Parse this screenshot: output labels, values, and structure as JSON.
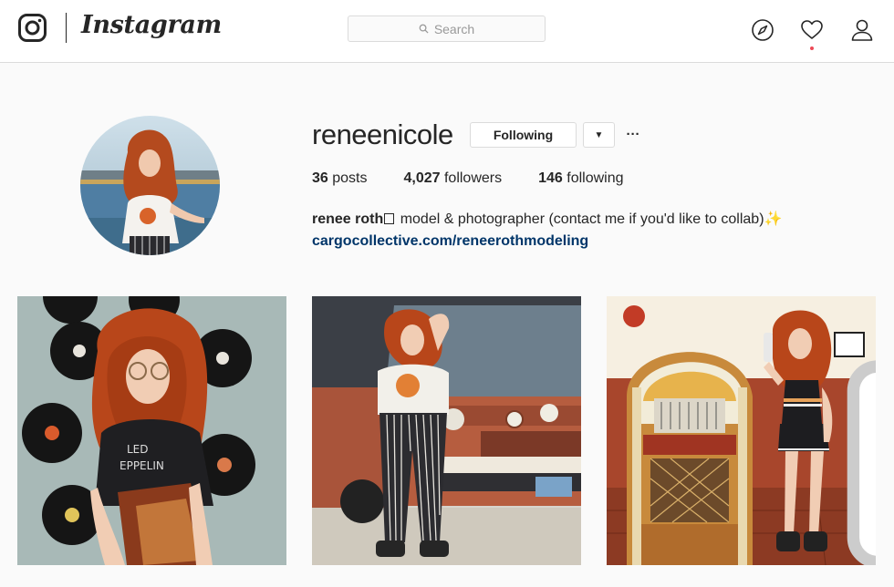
{
  "nav": {
    "wordmark": "Instagram",
    "search_placeholder": "Search",
    "icons": [
      "instagram-glyph-icon",
      "search-icon",
      "compass-icon",
      "heart-icon",
      "person-icon"
    ]
  },
  "profile": {
    "username": "reneenicole",
    "following_button": "Following",
    "dropdown_glyph": "▼",
    "more_glyph": "···",
    "stats": {
      "posts_count": "36",
      "posts_label": " posts",
      "followers_count": "4,027",
      "followers_label": " followers",
      "following_count": "146",
      "following_label": " following"
    },
    "bio": {
      "name": "renee roth",
      "text": " model & photographer (contact me if you'd like to collab)",
      "sparkle": "✨",
      "link": "cargocollective.com/reneerothmodeling"
    }
  },
  "posts": [
    {
      "subject": "records-wall-photo"
    },
    {
      "subject": "van-photo"
    },
    {
      "subject": "jukebox-photo",
      "multi": true
    }
  ],
  "colors": {
    "background": "#fafafa",
    "border": "#dbdbdb",
    "text": "#262626",
    "link": "#003569",
    "notification": "#ed4956"
  }
}
